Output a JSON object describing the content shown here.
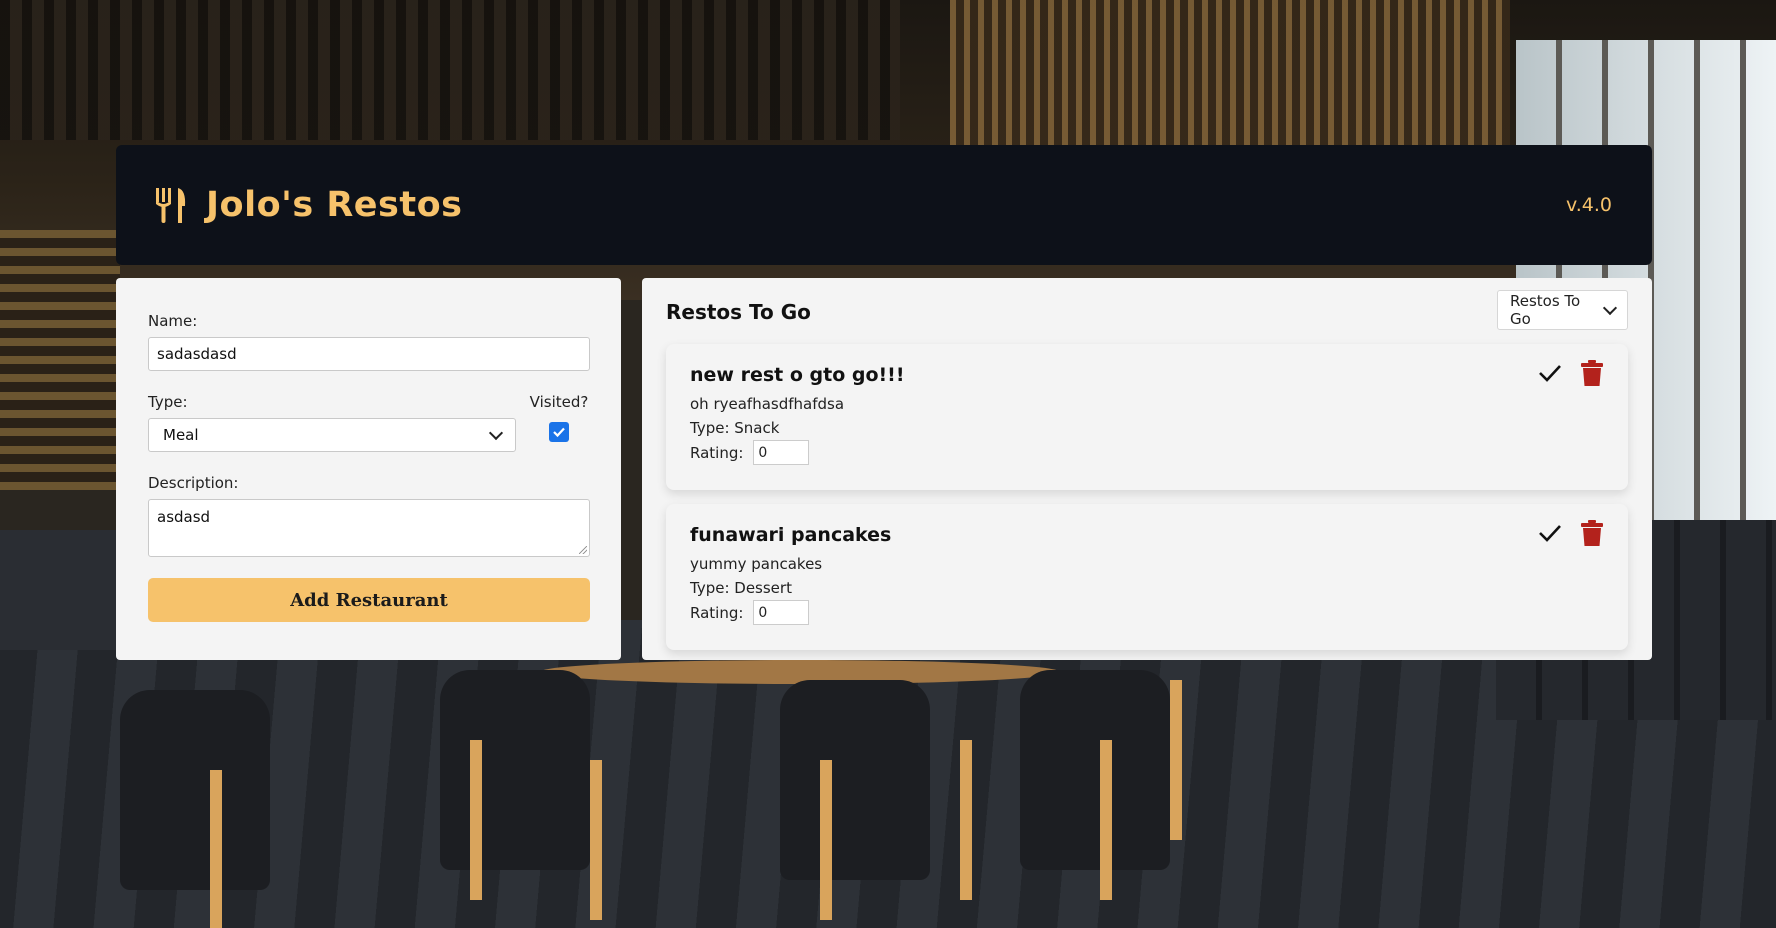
{
  "header": {
    "title": "Jolo's Restos",
    "version": "v.4.0",
    "accent_color": "#f6c26b",
    "icon": "utensils-icon"
  },
  "form": {
    "name_label": "Name:",
    "name_value": "sadasdasd",
    "type_label": "Type:",
    "type_value": "Meal",
    "visited_label": "Visited?",
    "visited_checked": true,
    "description_label": "Description:",
    "description_value": "asdasd",
    "submit_label": "Add Restaurant"
  },
  "list": {
    "title": "Restos To Go",
    "filter_value": "Restos To Go",
    "items": [
      {
        "name": "new rest o gto go!!!",
        "description": "oh ryeafhasdfhafdsa",
        "type_text": "Type: Snack",
        "rating_label": "Rating:",
        "rating_value": "0"
      },
      {
        "name": "funawari pancakes",
        "description": "yummy pancakes",
        "type_text": "Type: Dessert",
        "rating_label": "Rating:",
        "rating_value": "0"
      }
    ]
  },
  "colors": {
    "header_bg": "#0d1119",
    "delete_icon": "#b3221c",
    "checkbox": "#1a73e8"
  }
}
